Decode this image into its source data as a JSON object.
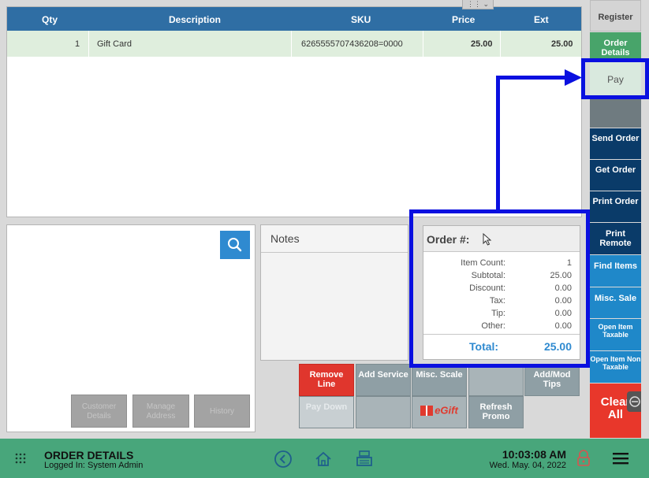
{
  "grid": {
    "headers": {
      "qty": "Qty",
      "description": "Description",
      "sku": "SKU",
      "price": "Price",
      "ext": "Ext"
    },
    "rows": [
      {
        "qty": "1",
        "description": "Gift Card",
        "sku": "6265555707436208=0000",
        "price": "25.00",
        "ext": "25.00"
      }
    ]
  },
  "customer": {
    "buttons": {
      "customer_details": "Customer Details",
      "manage_address": "Manage Address",
      "history": "History"
    }
  },
  "notes": {
    "title": "Notes"
  },
  "totals": {
    "order_label": "Order #:",
    "item_count_label": "Item Count:",
    "item_count": "1",
    "subtotal_label": "Subtotal:",
    "subtotal": "25.00",
    "discount_label": "Discount:",
    "discount": "0.00",
    "tax_label": "Tax:",
    "tax": "0.00",
    "tip_label": "Tip:",
    "tip": "0.00",
    "other_label": "Other:",
    "other": "0.00",
    "total_label": "Total:",
    "total": "25.00"
  },
  "actions": {
    "remove_line": "Remove Line",
    "add_service": "Add Service",
    "misc_scale": "Misc. Scale",
    "add_mod_tips": "Add/Mod Tips",
    "pay_down": "Pay Down",
    "egift": "eGift",
    "refresh_promo": "Refresh Promo"
  },
  "nav": {
    "register": "Register",
    "order_details": "Order Details",
    "pay": "Pay",
    "send_order": "Send Order",
    "get_order": "Get Order",
    "print_order": "Print Order",
    "print_remote": "Print Remote",
    "find_items": "Find Items",
    "misc_sale": "Misc. Sale",
    "open_item_taxable": "Open Item Taxable",
    "open_item_non_taxable": "Open Item Non Taxable",
    "clear_all": "Clear All"
  },
  "bottombar": {
    "title": "ORDER DETAILS",
    "logged_in": "Logged In:  System Admin",
    "time": "10:03:08 AM",
    "date": "Wed. May. 04, 2022"
  },
  "colors": {
    "header_blue": "#2f6ea4",
    "accent_green": "#48a46a",
    "navy": "#0a3b69",
    "blue": "#1f88c9",
    "red": "#e8372b",
    "highlight": "#0a10e0"
  }
}
